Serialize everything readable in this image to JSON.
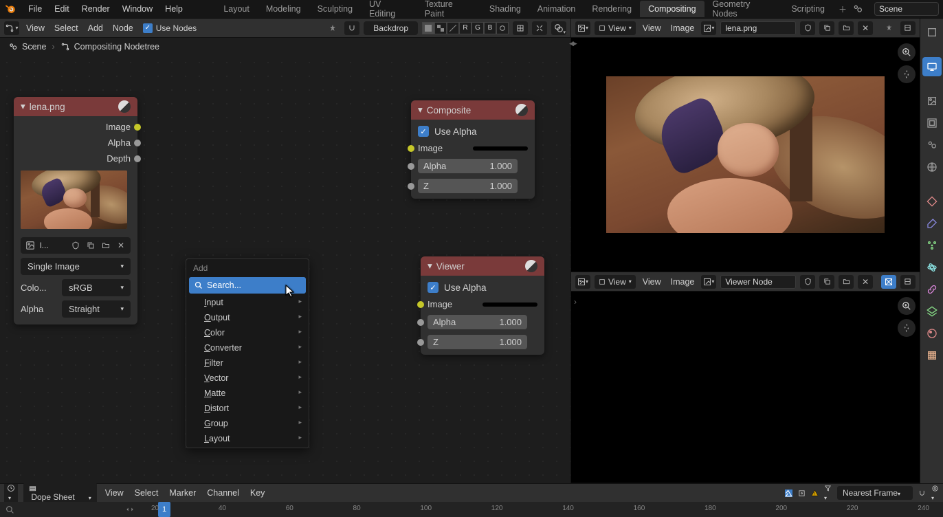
{
  "topbar": {
    "menus": [
      "File",
      "Edit",
      "Render",
      "Window",
      "Help"
    ],
    "workspaces": [
      "Layout",
      "Modeling",
      "Sculpting",
      "UV Editing",
      "Texture Paint",
      "Shading",
      "Animation",
      "Rendering",
      "Compositing",
      "Geometry Nodes",
      "Scripting"
    ],
    "active_workspace": "Compositing",
    "scene_label": "Scene"
  },
  "node_header": {
    "view": "View",
    "select": "Select",
    "add": "Add",
    "node": "Node",
    "use_nodes": "Use Nodes",
    "backdrop": "Backdrop"
  },
  "breadcrumb": {
    "scene": "Scene",
    "nodetree": "Compositing Nodetree"
  },
  "nodes": {
    "image": {
      "title": "lena.png",
      "outputs": [
        "Image",
        "Alpha",
        "Depth"
      ],
      "file_label_short": "l...",
      "source": "Single Image",
      "colorspace_lbl": "Colo...",
      "colorspace": "sRGB",
      "alpha_lbl": "Alpha",
      "alpha": "Straight"
    },
    "composite": {
      "title": "Composite",
      "use_alpha": "Use Alpha",
      "image_lbl": "Image",
      "alpha_lbl": "Alpha",
      "alpha_val": "1.000",
      "z_lbl": "Z",
      "z_val": "1.000"
    },
    "viewer": {
      "title": "Viewer",
      "use_alpha": "Use Alpha",
      "image_lbl": "Image",
      "alpha_lbl": "Alpha",
      "alpha_val": "1.000",
      "z_lbl": "Z",
      "z_val": "1.000"
    }
  },
  "add_menu": {
    "title": "Add",
    "search": "Search...",
    "items": [
      "Input",
      "Output",
      "Color",
      "Converter",
      "Filter",
      "Vector",
      "Matte",
      "Distort",
      "Group",
      "Layout"
    ]
  },
  "image_editor": {
    "view_dropdown": "View",
    "view": "View",
    "image": "Image",
    "file1": "lena.png",
    "file2": "Viewer Node"
  },
  "dope": {
    "mode": "Dope Sheet",
    "menus": [
      "View",
      "Select",
      "Marker",
      "Channel",
      "Key"
    ],
    "sync": "Nearest Frame",
    "current_frame": "1",
    "ticks": [
      "20",
      "40",
      "60",
      "80",
      "100",
      "120",
      "140",
      "160",
      "180",
      "200",
      "220",
      "240"
    ]
  }
}
